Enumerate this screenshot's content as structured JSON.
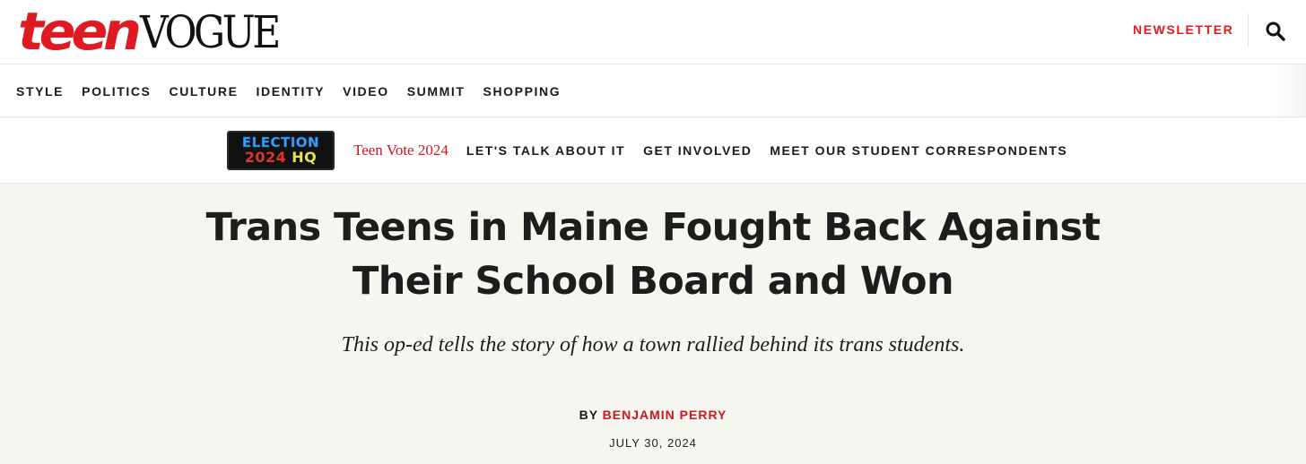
{
  "header": {
    "logo_teen": "teen",
    "logo_vogue": "VOGUE",
    "newsletter_label": "NEWSLETTER",
    "search_icon": "search-icon",
    "brand_color": "#e01a22"
  },
  "main_nav": {
    "items": [
      "STYLE",
      "POLITICS",
      "CULTURE",
      "IDENTITY",
      "VIDEO",
      "SUMMIT",
      "SHOPPING"
    ]
  },
  "sub_nav": {
    "badge": {
      "line1": "ELECTION",
      "year": "2024",
      "hq": "HQ"
    },
    "teen_vote": "Teen Vote 2024",
    "items": [
      "LET'S TALK ABOUT IT",
      "GET INVOLVED",
      "MEET OUR STUDENT CORRESPONDENTS"
    ]
  },
  "article": {
    "headline_line1": "Trans Teens in Maine Fought Back Against",
    "headline_line2": "Their School Board and Won",
    "dek": "This op-ed tells the story of how a town rallied behind its trans students.",
    "byline_prefix": "BY",
    "author": "BENJAMIN PERRY",
    "date": "JULY 30, 2024"
  }
}
